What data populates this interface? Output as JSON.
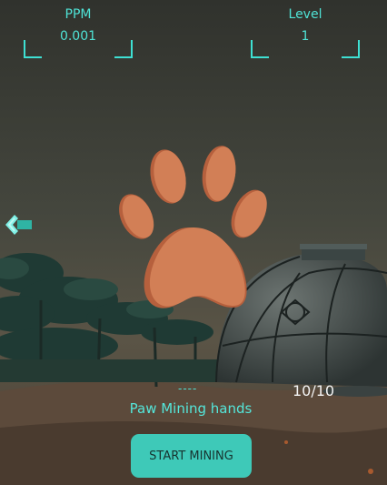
{
  "hud": {
    "ppm": {
      "label": "PPM",
      "value": "0.001"
    },
    "level": {
      "label": "Level",
      "value": "1"
    }
  },
  "navigation": {
    "back_icon": "chevron-left-double-icon"
  },
  "character": {
    "icon": "paw-icon",
    "color": "#d27f56"
  },
  "mining": {
    "progress_text": "----",
    "count": "10/10",
    "label": "Paw Mining hands",
    "button_label": "START MINING"
  },
  "colors": {
    "accent": "#4fe3d6",
    "button_bg": "#3ec9b8",
    "paw": "#d27f56",
    "paw_shadow": "#b6603d"
  }
}
